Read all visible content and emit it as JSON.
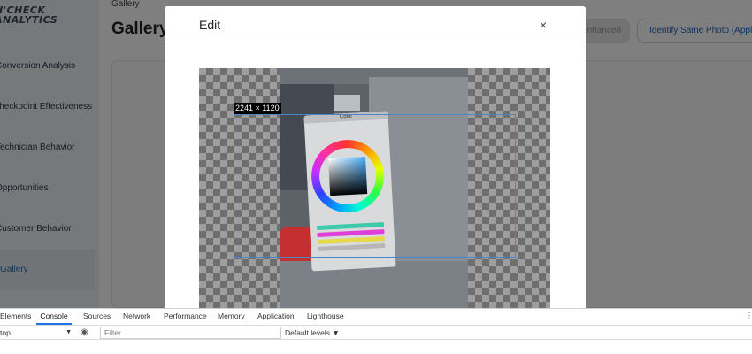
{
  "app": {
    "logo": "H'CHECK\nANALYTICS"
  },
  "sidebar": {
    "items": [
      {
        "label": "Conversion Analysis"
      },
      {
        "label": "Checkpoint Effectiveness"
      },
      {
        "label": "Technician Behavior"
      },
      {
        "label": "Opportunities"
      },
      {
        "label": "Customer Behavior"
      },
      {
        "label": "Gallery"
      }
    ]
  },
  "header": {
    "breadcrumb": "Gallery",
    "title": "Gallery",
    "enhanced_label": "Enhanced",
    "same_photo_label": "Identify Same Photo (Apply"
  },
  "modal": {
    "title": "Edit",
    "close_glyph": "×",
    "dimensions": "2241 × 1120",
    "color_window_title": "Color"
  },
  "devtools": {
    "tabs": [
      "Elements",
      "Console",
      "Sources",
      "Network",
      "Performance",
      "Memory",
      "Application",
      "Lighthouse"
    ],
    "active_tab": "Console",
    "context_value": "top",
    "filter_placeholder": "Filter",
    "levels_label": "Default levels ▼"
  },
  "colors": {
    "accent": "#1a73e8",
    "link": "#1f63b5",
    "selection": "#4a86c8"
  }
}
